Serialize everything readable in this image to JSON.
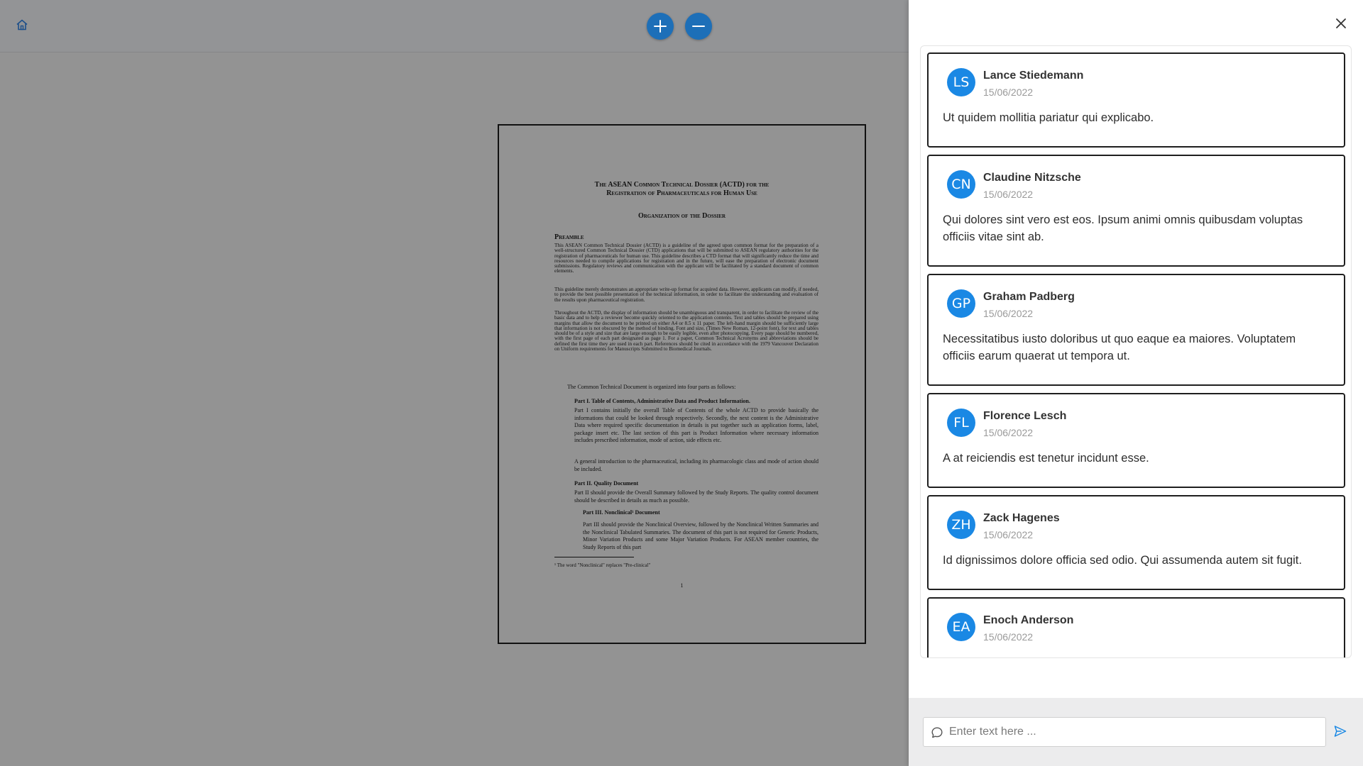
{
  "toolbar": {
    "home_icon": "home-icon",
    "zoom_in_icon": "plus-icon",
    "zoom_out_icon": "minus-icon",
    "accent_color": "#1d6fb8"
  },
  "document": {
    "title_line1": "The ASEAN Common Technical Dossier (ACTD) for the",
    "title_line2": "Registration of Pharmaceuticals for Human Use",
    "subtitle": "Organization of the Dossier",
    "preamble_heading": "Preamble",
    "preamble_p1": "This ASEAN Common Technical Dossier (ACTD) is a guideline of the agreed upon common format for the preparation of a well-structured Common Technical Dossier (CTD) applications that will be submitted to ASEAN regulatory authorities for the registration of pharmaceuticals for human use. This guideline describes a CTD format that will significantly reduce the time and resources needed to compile applications for registration and in the future, will ease the preparation of electronic document submissions. Regulatory reviews and communication with the applicant will be facilitated by a standard document of common elements.",
    "preamble_p2": "This guideline merely demonstrates an appropriate write-up format for acquired data. However, applicants can modify, if needed, to provide the best possible presentation of the technical information, in order to facilitate the understanding and evaluation of the results upon pharmaceutical registration.",
    "preamble_p3": "Throughout the ACTD, the display of information should be unambiguous and transparent, in order to facilitate the review of the basic data and to help a reviewer become quickly oriented to the application contents. Text and tables should be prepared using margins that allow the document to be printed on either A4 or 8.5 x 11 paper. The left-hand margin should be sufficiently large that information is not obscured by the method of binding. Font and size, (Times New Roman, 12-point font), for text and tables should be of a style and size that are large enough to be easily legible, even after photocopying. Every page should be numbered, with the first page of each part designated as page 1. For a paper, Common Technical Acronyms and abbreviations should be defined the first time they are used in each part. References should be cited in accordance with the 1979 Vancouver Declaration on Uniform requirements for Manuscripts Submitted to Biomedical Journals.",
    "intro": "The Common Technical Document is organized into four parts as follows:",
    "part1_heading": "Part I.  Table of Contents, Administrative Data and Product Information.",
    "part1_body": "Part I contains initially the overall Table of Contents of the whole ACTD to provide basically the informations that could be looked through respectively.  Secondly, the next content is the Administrative Data where required specific documentation in details is put together such as application forms, label, package insert etc.  The last section of this part is Product Information where necessary information includes prescribed information, mode of action, side effects etc.",
    "part1_body2": "A general introduction to the pharmaceutical, including its pharmacologic class and mode of action should be included.",
    "part2_heading": "Part II.  Quality Document",
    "part2_body": "Part II should provide the Overall Summary followed by the Study Reports.  The quality control document should be described in details as much as possible.",
    "part3_heading": "Part III. Nonclinical¹ Document",
    "part3_body": "Part III should provide the Nonclinical Overview, followed by the Nonclinical Written Summaries and the Nonclinical Tabulated Summaries.  The document of this part is not required for Generic Products, Minor Variation Products and some Major Variation Products.  For ASEAN member countries, the Study Reports of this part",
    "footnote": "¹ The word \"Nonclinical\" replaces \"Pre-clinical\"",
    "page_number": "1"
  },
  "panel": {
    "close_icon": "close-icon",
    "avatar_color": "#1a88e4",
    "comments": [
      {
        "initials": "LS",
        "author": "Lance Stiedemann",
        "date": "15/06/2022",
        "text": "Ut quidem mollitia pariatur qui explicabo."
      },
      {
        "initials": "CN",
        "author": "Claudine Nitzsche",
        "date": "15/06/2022",
        "text": "Qui dolores sint vero est eos. Ipsum animi omnis quibusdam voluptas officiis vitae sint ab."
      },
      {
        "initials": "GP",
        "author": "Graham Padberg",
        "date": "15/06/2022",
        "text": "Necessitatibus iusto doloribus ut quo eaque ea maiores. Voluptatem officiis earum quaerat ut tempora ut."
      },
      {
        "initials": "FL",
        "author": "Florence Lesch",
        "date": "15/06/2022",
        "text": "A at reiciendis est tenetur incidunt esse."
      },
      {
        "initials": "ZH",
        "author": "Zack Hagenes",
        "date": "15/06/2022",
        "text": "Id dignissimos dolore officia sed odio. Qui assumenda autem sit fugit."
      },
      {
        "initials": "EA",
        "author": "Enoch Anderson",
        "date": "15/06/2022",
        "text": ""
      }
    ],
    "composer": {
      "placeholder": "Enter text here ...",
      "value": "",
      "chat_icon": "chat-bubble-icon",
      "send_icon": "send-icon"
    }
  }
}
